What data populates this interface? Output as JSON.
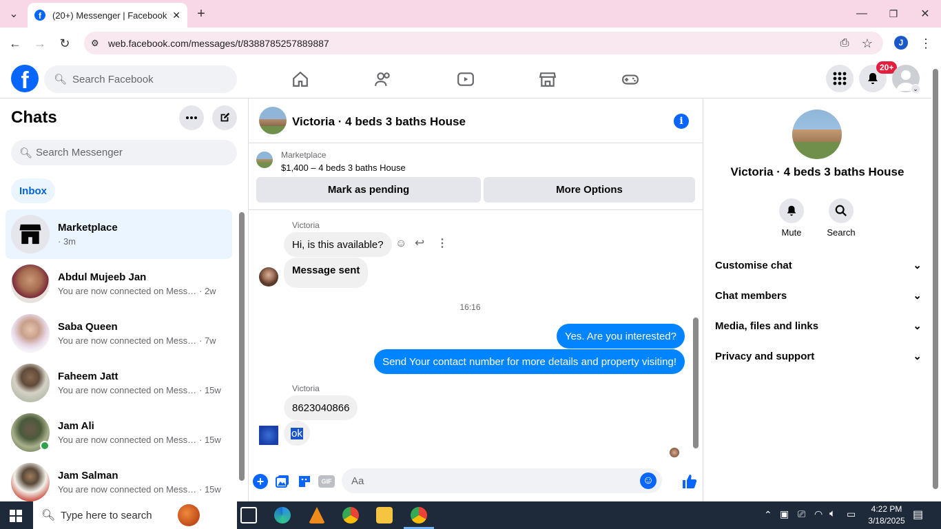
{
  "browser": {
    "tab_title": "(20+) Messenger | Facebook",
    "url": "web.facebook.com/messages/t/8388785257889887",
    "profile_initial": "J"
  },
  "fb_nav": {
    "search_placeholder": "Search Facebook",
    "notifications_badge": "20+"
  },
  "sidebar": {
    "title": "Chats",
    "search_placeholder": "Search Messenger",
    "filter_label": "Inbox",
    "chats": [
      {
        "name": "Marketplace",
        "preview": "",
        "time": "· 3m",
        "active": true
      },
      {
        "name": "Abdul Mujeeb Jan",
        "preview": "You are now connected on Messen...",
        "time": "· 2w"
      },
      {
        "name": "Saba Queen",
        "preview": "You are now connected on Messen...",
        "time": "· 7w"
      },
      {
        "name": "Faheem Jatt",
        "preview": "You are now connected on Messe...",
        "time": "· 15w"
      },
      {
        "name": "Jam Ali",
        "preview": "You are now connected on Messe...",
        "time": "· 15w",
        "online": true
      },
      {
        "name": "Jam Salman",
        "preview": "You are now connected on Messe...",
        "time": "· 15w"
      }
    ]
  },
  "conversation": {
    "title": "Victoria · 4 beds 3 baths House",
    "marketplace_label": "Marketplace",
    "listing": "$1,400 – 4 beds 3 baths House",
    "mark_pending": "Mark as pending",
    "more_options": "More Options",
    "sender_1": "Victoria",
    "msg_1": "Hi, is this available?",
    "msg_2": "Message sent",
    "timestamp": "16:16",
    "msg_3": "Yes. Are you interested?",
    "msg_4": "Send Your contact number for more details and property visiting!",
    "sender_2": "Victoria",
    "msg_5": "8623040866",
    "msg_6": "ok",
    "input_placeholder": "Aa"
  },
  "right_panel": {
    "name": "Victoria · 4 beds 3 baths House",
    "mute_label": "Mute",
    "search_label": "Search",
    "sections": [
      "Customise chat",
      "Chat members",
      "Media, files and links",
      "Privacy and support"
    ]
  },
  "taskbar": {
    "search_placeholder": "Type here to search",
    "time": "4:22 PM",
    "date": "3/18/2025"
  },
  "colors": {
    "accent": "#0866ff",
    "outgoing_bubble": "#0084ff",
    "incoming_bubble": "#f0f0f0",
    "tab_strip": "#f8d7e6"
  }
}
